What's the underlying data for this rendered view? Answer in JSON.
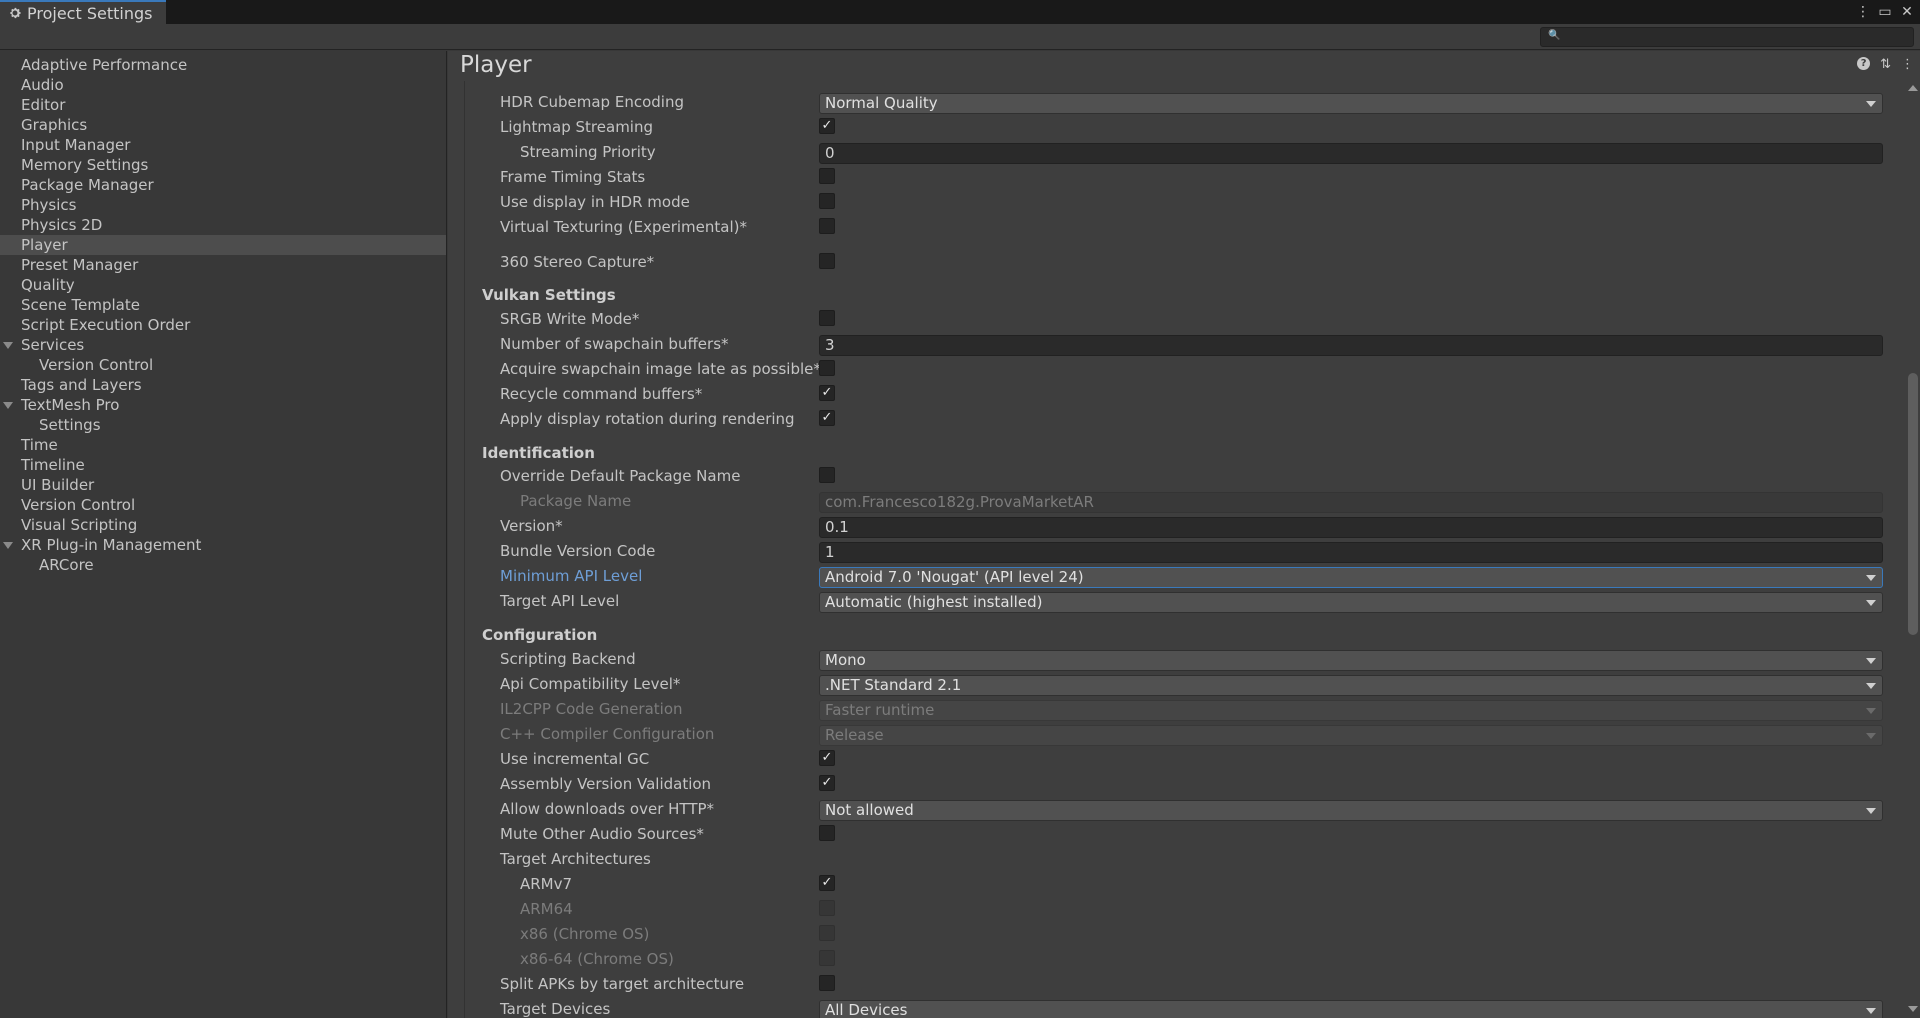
{
  "window": {
    "tab_title": "Project Settings",
    "search_placeholder": ""
  },
  "sidebar": {
    "items": [
      {
        "label": "Adaptive Performance"
      },
      {
        "label": "Audio"
      },
      {
        "label": "Editor"
      },
      {
        "label": "Graphics"
      },
      {
        "label": "Input Manager"
      },
      {
        "label": "Memory Settings"
      },
      {
        "label": "Package Manager"
      },
      {
        "label": "Physics"
      },
      {
        "label": "Physics 2D"
      },
      {
        "label": "Player",
        "selected": true
      },
      {
        "label": "Preset Manager"
      },
      {
        "label": "Quality"
      },
      {
        "label": "Scene Template"
      },
      {
        "label": "Script Execution Order"
      },
      {
        "label": "Services",
        "expanded": true
      },
      {
        "label": "Version Control",
        "child": true
      },
      {
        "label": "Tags and Layers"
      },
      {
        "label": "TextMesh Pro",
        "expanded": true
      },
      {
        "label": "Settings",
        "child": true
      },
      {
        "label": "Time"
      },
      {
        "label": "Timeline"
      },
      {
        "label": "UI Builder"
      },
      {
        "label": "Version Control"
      },
      {
        "label": "Visual Scripting"
      },
      {
        "label": "XR Plug-in Management",
        "expanded": true
      },
      {
        "label": "ARCore",
        "child": true
      }
    ]
  },
  "main": {
    "title": "Player",
    "rows": {
      "hdr_cubemap": {
        "label": "HDR Cubemap Encoding",
        "value": "Normal Quality"
      },
      "lightmap_streaming": {
        "label": "Lightmap Streaming",
        "checked": true
      },
      "streaming_priority": {
        "label": "Streaming Priority",
        "value": "0"
      },
      "frame_timing": {
        "label": "Frame Timing Stats",
        "checked": false
      },
      "hdr_display": {
        "label": "Use display in HDR mode",
        "checked": false
      },
      "virtual_texturing": {
        "label": "Virtual Texturing (Experimental)*",
        "checked": false
      },
      "stereo_capture": {
        "label": "360 Stereo Capture*",
        "checked": false
      },
      "srgb_write": {
        "label": "SRGB Write Mode*",
        "checked": false
      },
      "swapchain_buffers": {
        "label": "Number of swapchain buffers*",
        "value": "3"
      },
      "acquire_late": {
        "label": "Acquire swapchain image late as possible*",
        "checked": false
      },
      "recycle_buffers": {
        "label": "Recycle command buffers*",
        "checked": true
      },
      "display_rotation": {
        "label": "Apply display rotation during rendering",
        "checked": true
      },
      "override_package": {
        "label": "Override Default Package Name",
        "checked": false
      },
      "package_name": {
        "label": "Package Name",
        "value": "com.Francesco182g.ProvaMarketAR"
      },
      "version": {
        "label": "Version*",
        "value": "0.1"
      },
      "bundle_code": {
        "label": "Bundle Version Code",
        "value": "1"
      },
      "min_api": {
        "label": "Minimum API Level",
        "value": "Android 7.0 'Nougat' (API level 24)"
      },
      "target_api": {
        "label": "Target API Level",
        "value": "Automatic (highest installed)"
      },
      "scripting_backend": {
        "label": "Scripting Backend",
        "value": "Mono"
      },
      "api_compat": {
        "label": "Api Compatibility Level*",
        "value": ".NET Standard 2.1"
      },
      "il2cpp_gen": {
        "label": "IL2CPP Code Generation",
        "value": "Faster runtime"
      },
      "cpp_config": {
        "label": "C++ Compiler Configuration",
        "value": "Release"
      },
      "incremental_gc": {
        "label": "Use incremental GC",
        "checked": true
      },
      "assembly_validation": {
        "label": "Assembly Version Validation",
        "checked": true
      },
      "http_downloads": {
        "label": "Allow downloads over HTTP*",
        "value": "Not allowed"
      },
      "mute_audio": {
        "label": "Mute Other Audio Sources*",
        "checked": false
      },
      "target_arch": {
        "label": "Target Architectures"
      },
      "armv7": {
        "label": "ARMv7",
        "checked": true
      },
      "arm64": {
        "label": "ARM64",
        "checked": false
      },
      "x86": {
        "label": "x86 (Chrome OS)",
        "checked": false
      },
      "x86_64": {
        "label": "x86-64 (Chrome OS)",
        "checked": false
      },
      "split_apks": {
        "label": "Split APKs by target architecture",
        "checked": false
      },
      "target_devices": {
        "label": "Target Devices",
        "value": "All Devices"
      }
    },
    "sections": {
      "vulkan": "Vulkan Settings",
      "identification": "Identification",
      "configuration": "Configuration"
    }
  },
  "checkmark": "✓",
  "colors": {
    "accent": "#3a79bb",
    "highlight_label": "#6e9ed6",
    "background": "#3e3e3e"
  }
}
